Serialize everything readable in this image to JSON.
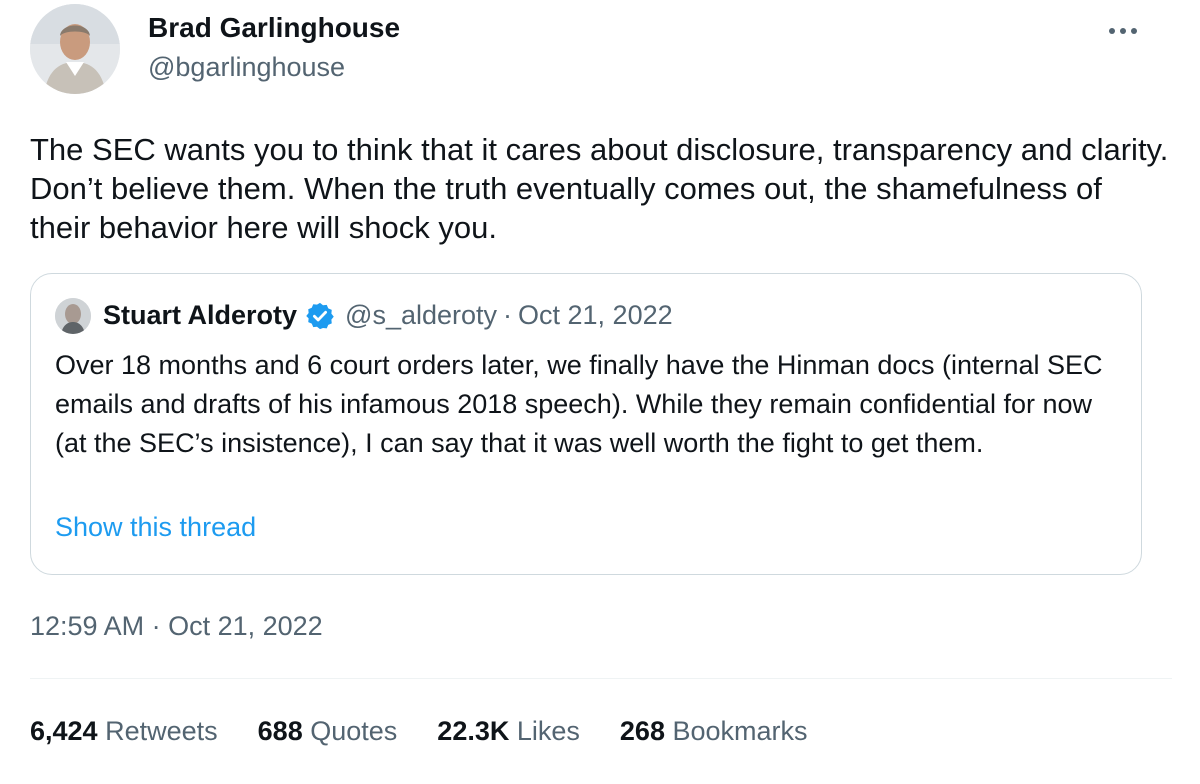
{
  "author": {
    "name": "Brad Garlinghouse",
    "handle": "@bgarlinghouse"
  },
  "tweet": {
    "text": "The SEC wants you to think that it cares about disclosure, transparency and clarity. Don’t believe them. When the truth eventually comes out, the shamefulness of their behavior here will shock you.",
    "timestamp": "12:59 AM · Oct 21, 2022"
  },
  "quoted": {
    "name": "Stuart Alderoty",
    "handle": "@s_alderoty",
    "separator": "·",
    "date": "Oct 21, 2022",
    "text": "Over 18 months and 6 court orders later, we finally have the Hinman docs (internal SEC emails and drafts of his infamous 2018 speech). While they remain confidential for now (at the SEC’s insistence), I can say that it was well worth the fight to get them.",
    "link": "Show this thread"
  },
  "stats": [
    {
      "value": "6,424",
      "label": "Retweets"
    },
    {
      "value": "688",
      "label": "Quotes"
    },
    {
      "value": "22.3K",
      "label": "Likes"
    },
    {
      "value": "268",
      "label": "Bookmarks"
    }
  ],
  "colors": {
    "text": "#0f1419",
    "secondary": "#536471",
    "link": "#1d9bf0",
    "verified": "#1d9bf0",
    "border": "#cfd9de"
  },
  "icons": {
    "more": "more-horizontal-icon",
    "verified": "verified-badge-icon"
  }
}
